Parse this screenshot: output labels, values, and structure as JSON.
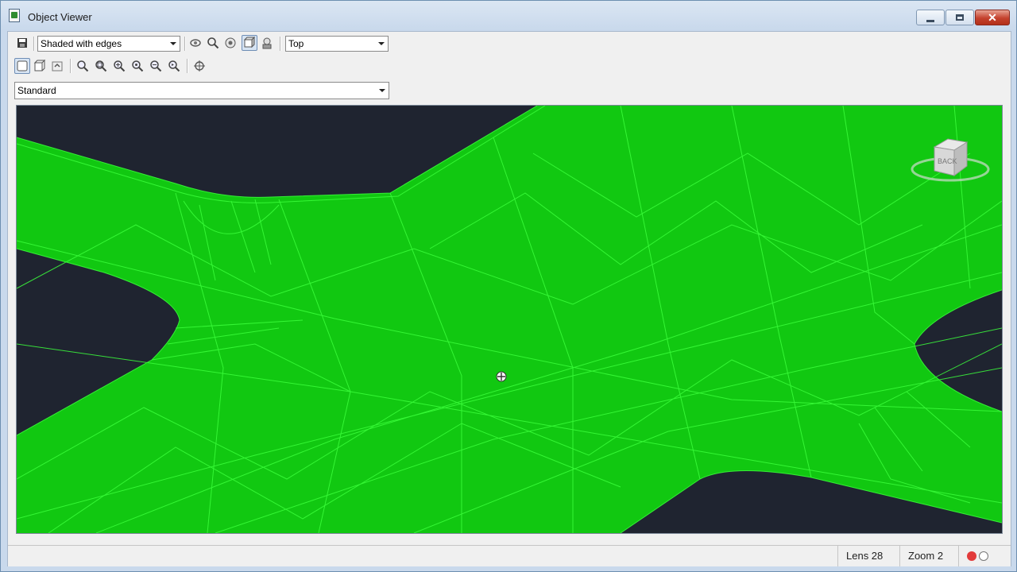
{
  "window": {
    "title": "Object Viewer"
  },
  "toolbar": {
    "visual_style": "Shaded with edges",
    "view_direction": "Top",
    "ucs": "Standard"
  },
  "viewcube": {
    "face_label": "BACK"
  },
  "status": {
    "lens": "Lens 28",
    "zoom": "Zoom 2"
  },
  "colors": {
    "surface": "#11c811",
    "edges": "#3cff3c",
    "background": "#1f2430"
  }
}
